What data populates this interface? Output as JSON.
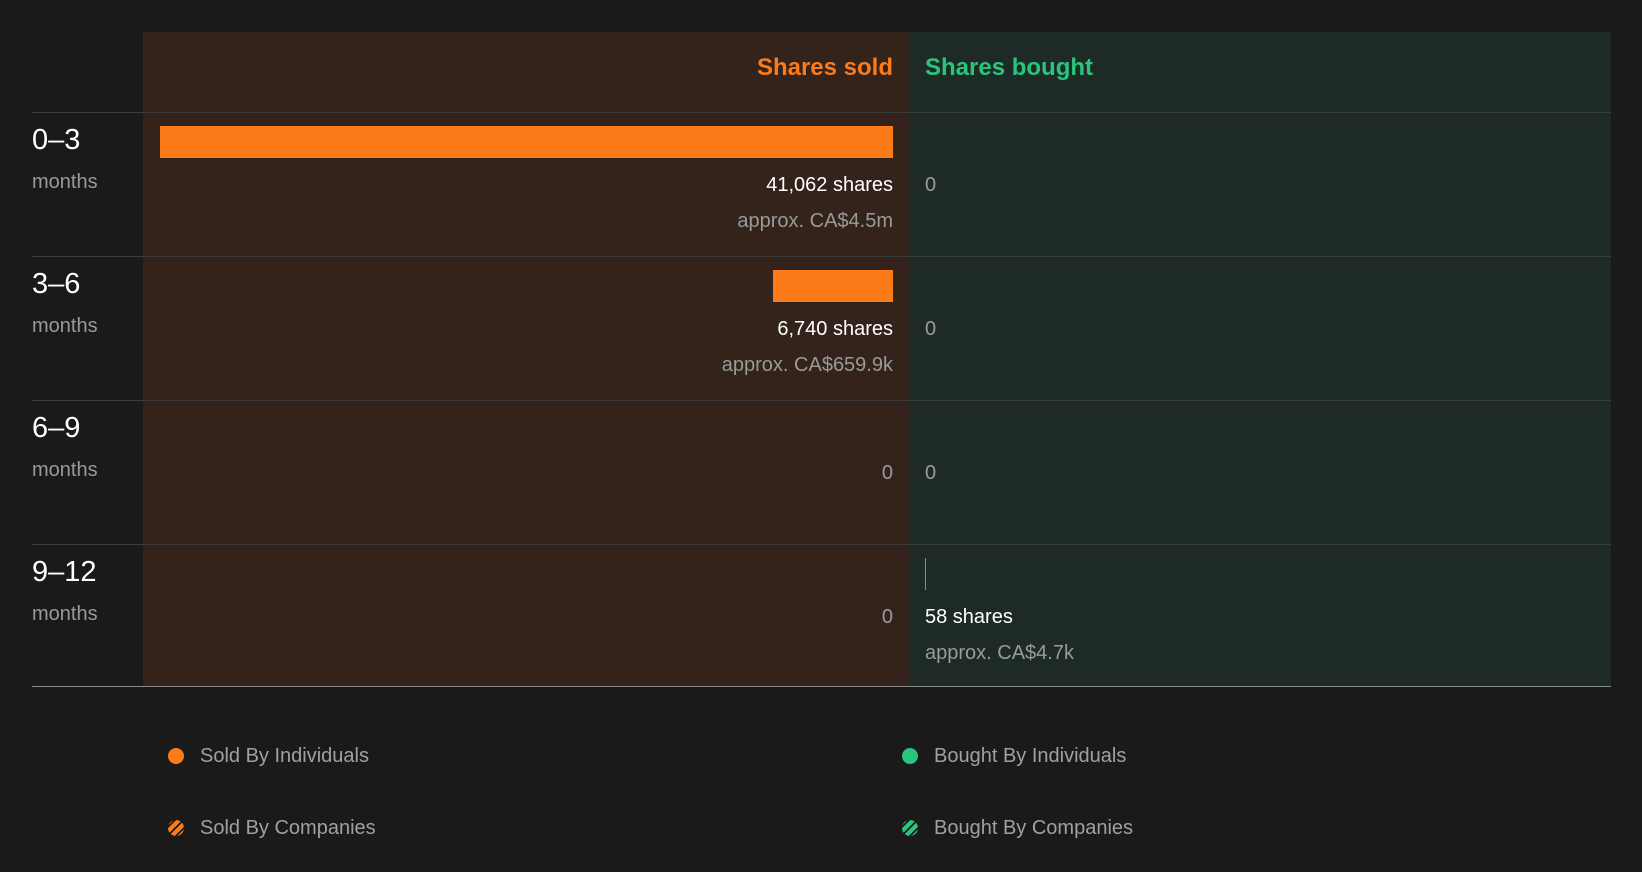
{
  "colors": {
    "sold": "#fb7a19",
    "bought": "#2bc47d",
    "sold_bg": "#33231b",
    "bought_bg": "#1d2a25"
  },
  "chart_data": {
    "type": "bar",
    "orientation": "horizontal-diverging",
    "headers": {
      "sold": "Shares sold",
      "bought": "Shares bought"
    },
    "categories": [
      {
        "range": "0-3",
        "unit": "months"
      },
      {
        "range": "3-6",
        "unit": "months"
      },
      {
        "range": "6-9",
        "unit": "months"
      },
      {
        "range": "9-12",
        "unit": "months"
      }
    ],
    "series": [
      {
        "name": "Shares sold",
        "values": [
          41062,
          6740,
          0,
          0
        ],
        "shares_labels": [
          "41,062 shares",
          "6,740 shares",
          "0",
          "0"
        ],
        "value_labels": [
          "approx. CA$4.5m",
          "approx. CA$659.9k",
          "",
          ""
        ]
      },
      {
        "name": "Shares bought",
        "values": [
          0,
          0,
          0,
          58
        ],
        "shares_labels": [
          "0",
          "0",
          "0",
          "58 shares"
        ],
        "value_labels": [
          "",
          "",
          "",
          "approx. CA$4.7k"
        ]
      }
    ],
    "legend": {
      "placement": "bottom",
      "items": [
        {
          "label": "Sold By Individuals",
          "color": "#fb7a19",
          "pattern": "solid"
        },
        {
          "label": "Bought By Individuals",
          "color": "#2bc47d",
          "pattern": "solid"
        },
        {
          "label": "Sold By Companies",
          "color": "#fb7a19",
          "pattern": "striped"
        },
        {
          "label": "Bought By Companies",
          "color": "#2bc47d",
          "pattern": "striped"
        }
      ]
    }
  }
}
